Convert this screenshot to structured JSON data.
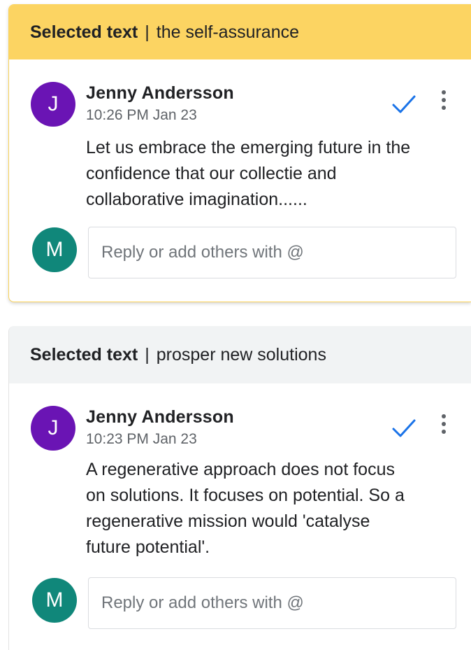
{
  "threads": [
    {
      "header": {
        "label": "Selected text",
        "separator": "|",
        "quote": "the self-assurance"
      },
      "comment": {
        "avatar_initial": "J",
        "author": "Jenny Andersson",
        "timestamp": "10:26 PM Jan 23",
        "lines": [
          "Let us embrace the emerging future in the",
          "confidence that our collectie and",
          "collaborative imagination......"
        ]
      },
      "reply": {
        "avatar_initial": "M",
        "placeholder": "Reply or add others with @",
        "value": ""
      }
    },
    {
      "header": {
        "label": "Selected text",
        "separator": "|",
        "quote": "prosper new solutions"
      },
      "comment": {
        "avatar_initial": "J",
        "author": "Jenny Andersson",
        "timestamp": "10:23 PM Jan 23",
        "lines": [
          "A regenerative approach does not focus",
          "on solutions. It focuses on potential. So a",
          "regenerative mission would 'catalyse",
          "future potential'."
        ]
      },
      "reply": {
        "avatar_initial": "M",
        "placeholder": "Reply or add others with @",
        "value": ""
      }
    }
  ],
  "colors": {
    "active_header": "#fcd462",
    "inactive_header": "#f1f3f4",
    "author_avatar": "#6a14b4",
    "user_avatar": "#10877a",
    "resolve_check": "#1a73e8"
  },
  "icons": {
    "resolve": "check-icon",
    "menu": "more-vert-icon"
  }
}
